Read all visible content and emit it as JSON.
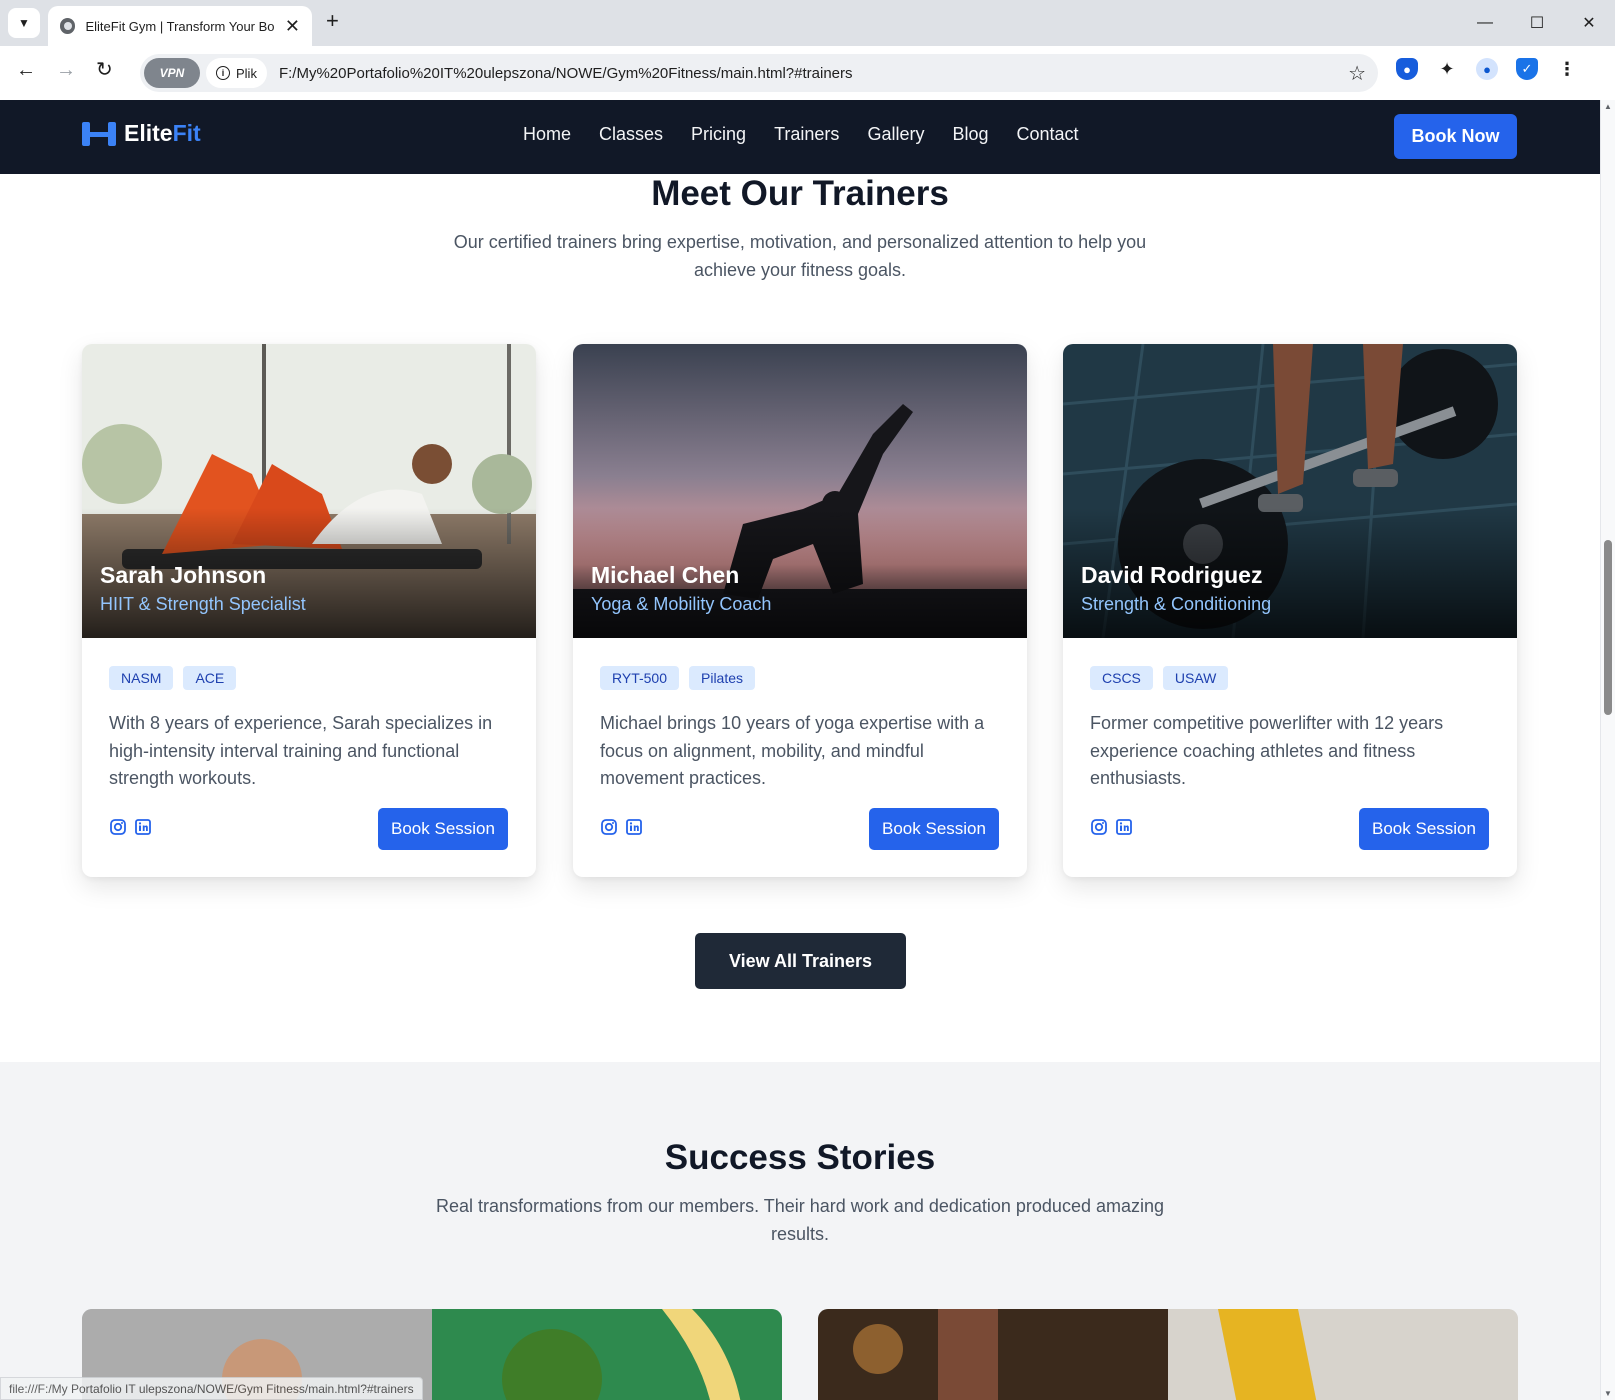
{
  "browser": {
    "tab_title": "EliteFit Gym | Transform Your Body",
    "vpn_label": "VPN",
    "site_info_label": "Plik",
    "url": "F:/My%20Portafolio%20IT%20ulepszona/NOWE/Gym%20Fitness/main.html?#trainers",
    "status_url": "file:///F:/My Portafolio IT ulepszona/NOWE/Gym Fitness/main.html?#trainers"
  },
  "header": {
    "logo_main": "Elite",
    "logo_accent": "Fit",
    "nav": [
      "Home",
      "Classes",
      "Pricing",
      "Trainers",
      "Gallery",
      "Blog",
      "Contact"
    ],
    "cta": "Book Now"
  },
  "trainers_section": {
    "title": "Meet Our Trainers",
    "subtitle_line1": "Our certified trainers bring expertise, motivation, and personalized attention to help you",
    "subtitle_line2": "achieve your fitness goals.",
    "cards": [
      {
        "name": "Sarah Johnson",
        "role": "HIIT & Strength Specialist",
        "badges": [
          "NASM",
          "ACE"
        ],
        "bio": "With 8 years of experience, Sarah specializes in high-intensity interval training and functional strength workouts.",
        "button": "Book Session"
      },
      {
        "name": "Michael Chen",
        "role": "Yoga & Mobility Coach",
        "badges": [
          "RYT-500",
          "Pilates"
        ],
        "bio": "Michael brings 10 years of yoga expertise with a focus on alignment, mobility, and mindful movement practices.",
        "button": "Book Session"
      },
      {
        "name": "David Rodriguez",
        "role": "Strength & Conditioning",
        "badges": [
          "CSCS",
          "USAW"
        ],
        "bio": "Former competitive powerlifter with 12 years experience coaching athletes and fitness enthusiasts.",
        "button": "Book Session"
      }
    ],
    "view_all": "View All Trainers"
  },
  "stories_section": {
    "title": "Success Stories",
    "subtitle_line1": "Real transformations from our members. Their hard work and dedication produced amazing",
    "subtitle_line2": "results."
  },
  "colors": {
    "brand": "#2563eb",
    "header_bg": "#111827",
    "accent": "#3b82f6"
  },
  "icons": [
    "chevron-down-icon",
    "globe-icon",
    "close-icon",
    "plus-icon",
    "back-icon",
    "forward-icon",
    "reload-icon",
    "info-icon",
    "star-icon",
    "bitwarden-icon",
    "puzzle-icon",
    "profile-icon",
    "shield-icon",
    "kebab-menu-icon",
    "dumbbell-icon",
    "instagram-icon",
    "linkedin-icon"
  ]
}
